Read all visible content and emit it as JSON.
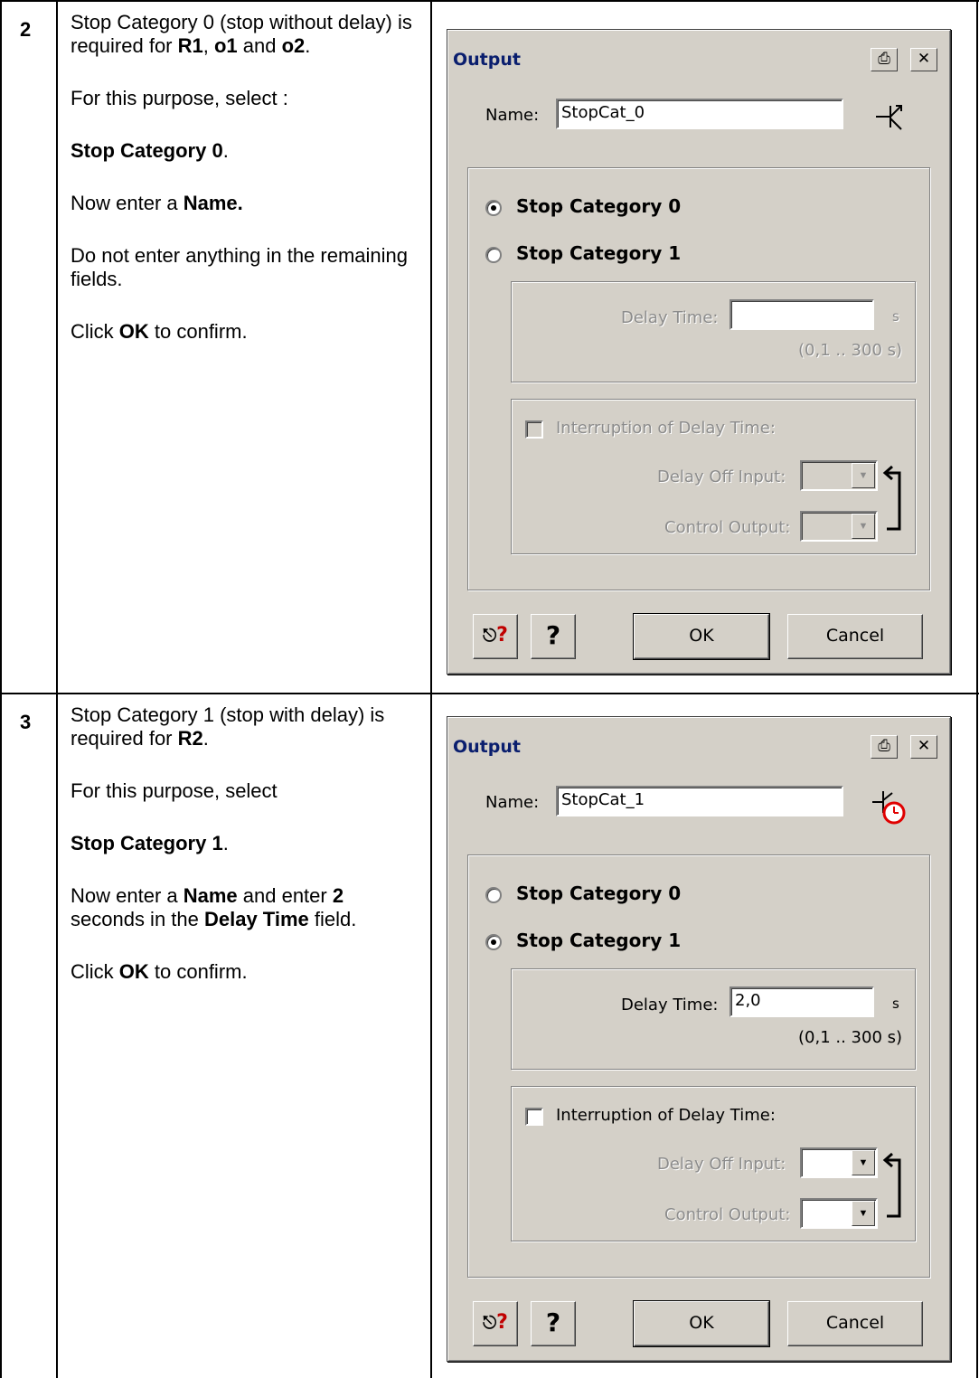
{
  "steps": [
    {
      "number": "2",
      "instructions": {
        "p1_pre": "Stop Category 0 (stop without delay) is required for ",
        "p1_b1": "R1",
        "p1_sep1": ", ",
        "p1_b2": "o1",
        "p1_sep2": " and ",
        "p1_b3": "o2",
        "p1_end": ".",
        "p2": "For this purpose, select :",
        "p3_b": "Stop Category 0",
        "p3_end": ".",
        "p4_pre": "Now enter a ",
        "p4_b": "Name.",
        "p5": "Do not enter anything in the remaining fields.",
        "p6_pre": "Click ",
        "p6_b": "OK",
        "p6_end": " to confirm."
      },
      "dialog": {
        "title": "Output",
        "name_label": "Name:",
        "name_value": "StopCat_0",
        "icon": "switch-contact-icon",
        "radio_cat0": "Stop Category 0",
        "radio_cat1": "Stop Category 1",
        "selected": "cat0",
        "delay_label": "Delay Time:",
        "delay_value": "",
        "delay_unit": "s",
        "delay_range": "(0,1 .. 300 s)",
        "interrupt_label": "Interruption of Delay Time:",
        "delay_off_label": "Delay Off Input:",
        "control_output_label": "Control Output:",
        "ok_label": "OK",
        "cancel_label": "Cancel",
        "help_label": "?"
      }
    },
    {
      "number": "3",
      "instructions": {
        "p1_pre": "Stop Category 1 (stop with delay) is required for ",
        "p1_b1": "R2",
        "p1_end": ".",
        "p2": "For this purpose, select",
        "p3_b": "Stop Category 1",
        "p3_end": ".",
        "p4_pre": "Now enter a ",
        "p4_b": "Name",
        "p4_mid": " and enter ",
        "p4_b2": "2",
        "p4_mid2": " seconds in the ",
        "p4_b3": "Delay Time",
        "p4_end": " field.",
        "p6_pre": "Click ",
        "p6_b": "OK",
        "p6_end": " to confirm."
      },
      "dialog": {
        "title": "Output",
        "name_label": "Name:",
        "name_value": "StopCat_1",
        "icon": "timer-contact-icon",
        "radio_cat0": "Stop Category 0",
        "radio_cat1": "Stop Category 1",
        "selected": "cat1",
        "delay_label": "Delay Time:",
        "delay_value": "2,0",
        "delay_unit": "s",
        "delay_range": "(0,1 .. 300 s)",
        "interrupt_label": "Interruption of Delay Time:",
        "delay_off_label": "Delay Off Input:",
        "control_output_label": "Control Output:",
        "ok_label": "OK",
        "cancel_label": "Cancel",
        "help_label": "?"
      }
    }
  ],
  "colors": {
    "dialog_bg": "#d4d0c8",
    "title_text": "#0a1e6e",
    "help_red": "#c00000",
    "timer_red": "#e00000"
  }
}
